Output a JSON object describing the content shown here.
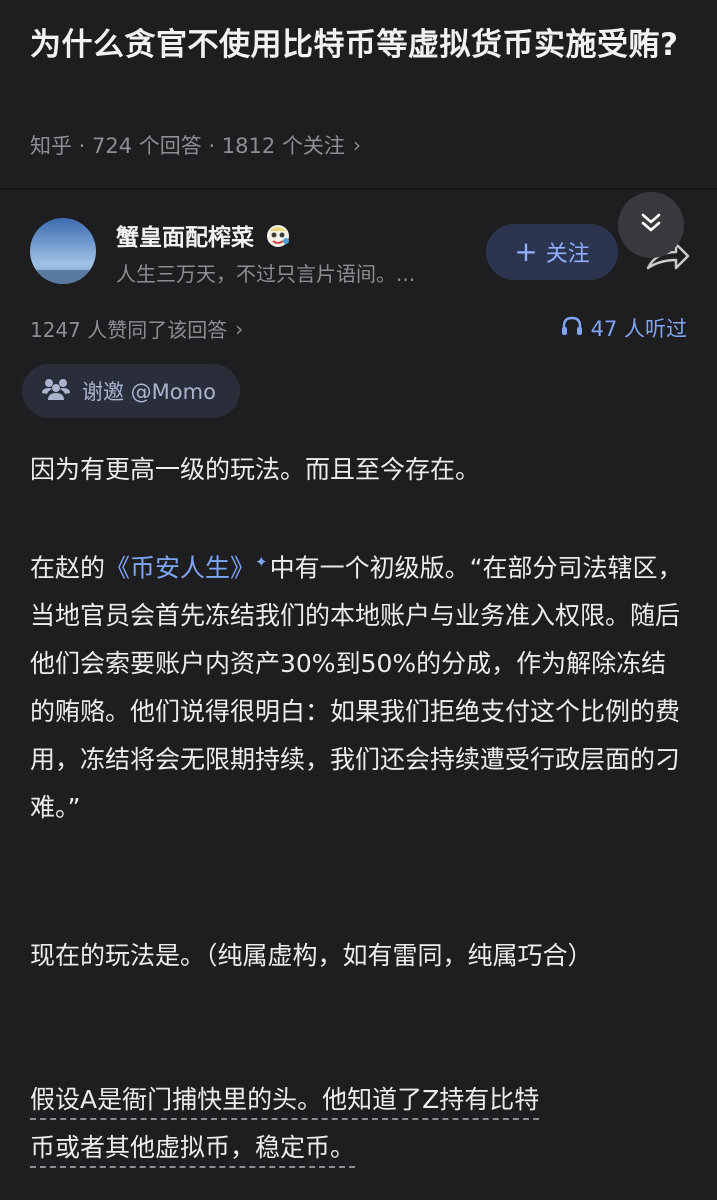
{
  "question": {
    "title": "为什么贪官不使用比特币等虚拟货币实施受贿?",
    "meta": "知乎 · 724 个回答 · 1812 个关注"
  },
  "author": {
    "name": "蟹皇面配榨菜",
    "signature": "人生三万天，不过只言片语间。...",
    "follow_label": "关注"
  },
  "stats": {
    "votes": "1247 人赞同了该回答",
    "listens": "47 人听过"
  },
  "invite": {
    "label": "谢邀 @Momo"
  },
  "answer": {
    "p1": "因为有更高一级的玩法。而且至今存在。",
    "p2_prefix": "在赵的",
    "p2_link": "《币安人生》",
    "p2_rest": "中有一个初级版。“在部分司法辖区，当地官员会首先冻结我们的本地账户与业务准入权限。随后他们会索要账户内资产30%到50%的分成，作为解除冻结的贿赂。他们说得很明白：如果我们拒绝支付这个比例的费用，冻结将会无限期持续，我们还会持续遭受行政层面的刁难。”",
    "p3": "现在的玩法是。（纯属虚构，如有雷同，纯属巧合）",
    "p4_line1": "假设A是衙门捕快里的头。他知道了Z持有比特",
    "p4_line2": "币或者其他虚拟币，稳定币。"
  },
  "icons": {
    "collapse": "chevrons-down-icon",
    "headphones": "headphones-icon",
    "invite": "people-icon",
    "link_spark": "sparkle-icon"
  },
  "colors": {
    "background": "#1e1e20",
    "link": "#7fa6f5",
    "muted": "#8d8d93"
  }
}
